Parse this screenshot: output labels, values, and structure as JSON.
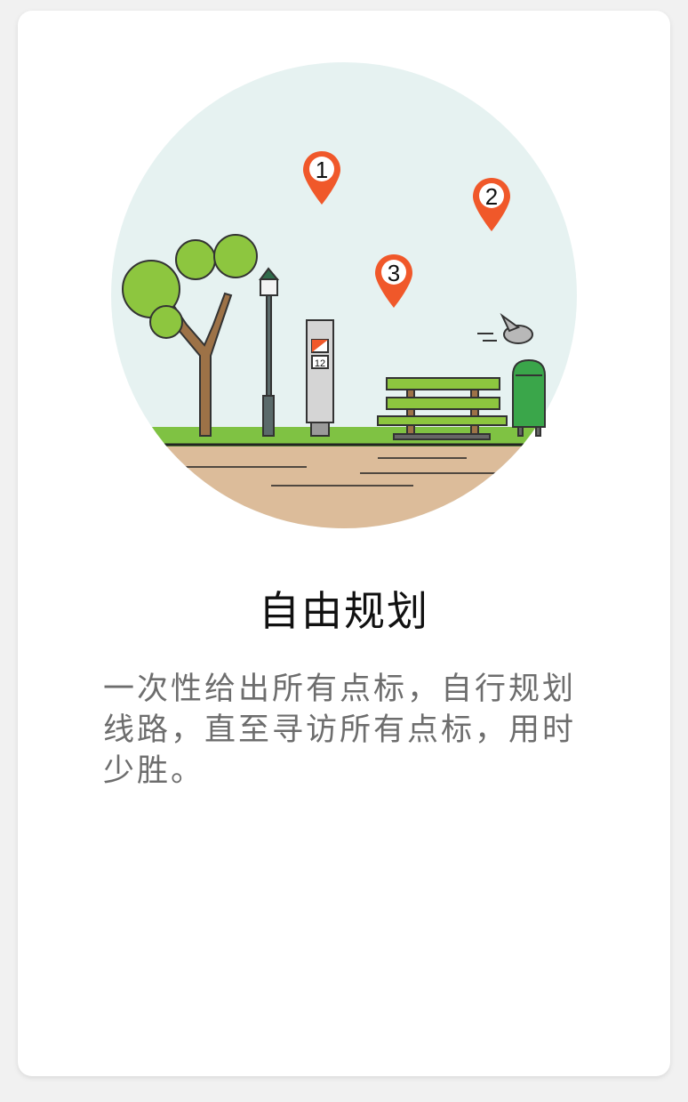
{
  "card": {
    "title": "自由规划",
    "description": "一次性给出所有点标，自行规划线路，直至寻访所有点标，用时少胜。"
  },
  "illustration": {
    "markers": [
      "1",
      "2",
      "3"
    ],
    "control_post_number": "12",
    "colors": {
      "sky": "#e6f2f1",
      "grass": "#7fc243",
      "ground": "#dcbc9a",
      "marker": "#f0582a",
      "tree": "#8dc63f",
      "mailbox": "#3aa64a"
    }
  }
}
